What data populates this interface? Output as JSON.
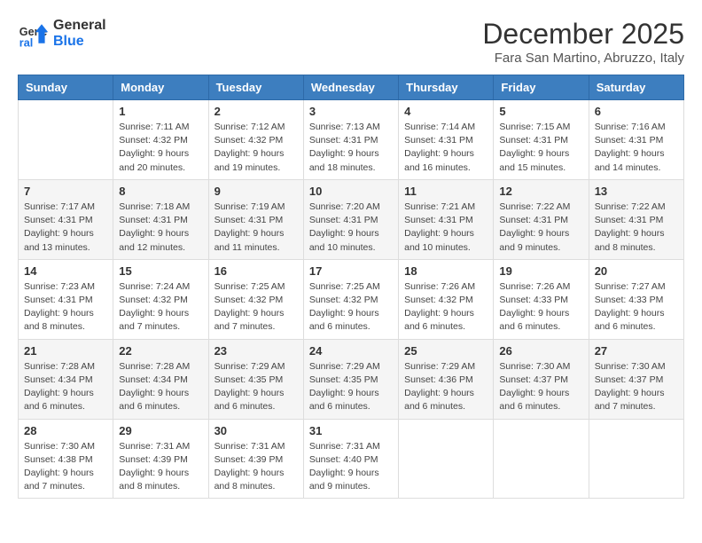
{
  "header": {
    "logo_line1": "General",
    "logo_line2": "Blue",
    "month": "December 2025",
    "location": "Fara San Martino, Abruzzo, Italy"
  },
  "weekdays": [
    "Sunday",
    "Monday",
    "Tuesday",
    "Wednesday",
    "Thursday",
    "Friday",
    "Saturday"
  ],
  "weeks": [
    [
      {
        "day": "",
        "info": ""
      },
      {
        "day": "1",
        "info": "Sunrise: 7:11 AM\nSunset: 4:32 PM\nDaylight: 9 hours\nand 20 minutes."
      },
      {
        "day": "2",
        "info": "Sunrise: 7:12 AM\nSunset: 4:32 PM\nDaylight: 9 hours\nand 19 minutes."
      },
      {
        "day": "3",
        "info": "Sunrise: 7:13 AM\nSunset: 4:31 PM\nDaylight: 9 hours\nand 18 minutes."
      },
      {
        "day": "4",
        "info": "Sunrise: 7:14 AM\nSunset: 4:31 PM\nDaylight: 9 hours\nand 16 minutes."
      },
      {
        "day": "5",
        "info": "Sunrise: 7:15 AM\nSunset: 4:31 PM\nDaylight: 9 hours\nand 15 minutes."
      },
      {
        "day": "6",
        "info": "Sunrise: 7:16 AM\nSunset: 4:31 PM\nDaylight: 9 hours\nand 14 minutes."
      }
    ],
    [
      {
        "day": "7",
        "info": "Sunrise: 7:17 AM\nSunset: 4:31 PM\nDaylight: 9 hours\nand 13 minutes."
      },
      {
        "day": "8",
        "info": "Sunrise: 7:18 AM\nSunset: 4:31 PM\nDaylight: 9 hours\nand 12 minutes."
      },
      {
        "day": "9",
        "info": "Sunrise: 7:19 AM\nSunset: 4:31 PM\nDaylight: 9 hours\nand 11 minutes."
      },
      {
        "day": "10",
        "info": "Sunrise: 7:20 AM\nSunset: 4:31 PM\nDaylight: 9 hours\nand 10 minutes."
      },
      {
        "day": "11",
        "info": "Sunrise: 7:21 AM\nSunset: 4:31 PM\nDaylight: 9 hours\nand 10 minutes."
      },
      {
        "day": "12",
        "info": "Sunrise: 7:22 AM\nSunset: 4:31 PM\nDaylight: 9 hours\nand 9 minutes."
      },
      {
        "day": "13",
        "info": "Sunrise: 7:22 AM\nSunset: 4:31 PM\nDaylight: 9 hours\nand 8 minutes."
      }
    ],
    [
      {
        "day": "14",
        "info": "Sunrise: 7:23 AM\nSunset: 4:31 PM\nDaylight: 9 hours\nand 8 minutes."
      },
      {
        "day": "15",
        "info": "Sunrise: 7:24 AM\nSunset: 4:32 PM\nDaylight: 9 hours\nand 7 minutes."
      },
      {
        "day": "16",
        "info": "Sunrise: 7:25 AM\nSunset: 4:32 PM\nDaylight: 9 hours\nand 7 minutes."
      },
      {
        "day": "17",
        "info": "Sunrise: 7:25 AM\nSunset: 4:32 PM\nDaylight: 9 hours\nand 6 minutes."
      },
      {
        "day": "18",
        "info": "Sunrise: 7:26 AM\nSunset: 4:32 PM\nDaylight: 9 hours\nand 6 minutes."
      },
      {
        "day": "19",
        "info": "Sunrise: 7:26 AM\nSunset: 4:33 PM\nDaylight: 9 hours\nand 6 minutes."
      },
      {
        "day": "20",
        "info": "Sunrise: 7:27 AM\nSunset: 4:33 PM\nDaylight: 9 hours\nand 6 minutes."
      }
    ],
    [
      {
        "day": "21",
        "info": "Sunrise: 7:28 AM\nSunset: 4:34 PM\nDaylight: 9 hours\nand 6 minutes."
      },
      {
        "day": "22",
        "info": "Sunrise: 7:28 AM\nSunset: 4:34 PM\nDaylight: 9 hours\nand 6 minutes."
      },
      {
        "day": "23",
        "info": "Sunrise: 7:29 AM\nSunset: 4:35 PM\nDaylight: 9 hours\nand 6 minutes."
      },
      {
        "day": "24",
        "info": "Sunrise: 7:29 AM\nSunset: 4:35 PM\nDaylight: 9 hours\nand 6 minutes."
      },
      {
        "day": "25",
        "info": "Sunrise: 7:29 AM\nSunset: 4:36 PM\nDaylight: 9 hours\nand 6 minutes."
      },
      {
        "day": "26",
        "info": "Sunrise: 7:30 AM\nSunset: 4:37 PM\nDaylight: 9 hours\nand 6 minutes."
      },
      {
        "day": "27",
        "info": "Sunrise: 7:30 AM\nSunset: 4:37 PM\nDaylight: 9 hours\nand 7 minutes."
      }
    ],
    [
      {
        "day": "28",
        "info": "Sunrise: 7:30 AM\nSunset: 4:38 PM\nDaylight: 9 hours\nand 7 minutes."
      },
      {
        "day": "29",
        "info": "Sunrise: 7:31 AM\nSunset: 4:39 PM\nDaylight: 9 hours\nand 8 minutes."
      },
      {
        "day": "30",
        "info": "Sunrise: 7:31 AM\nSunset: 4:39 PM\nDaylight: 9 hours\nand 8 minutes."
      },
      {
        "day": "31",
        "info": "Sunrise: 7:31 AM\nSunset: 4:40 PM\nDaylight: 9 hours\nand 9 minutes."
      },
      {
        "day": "",
        "info": ""
      },
      {
        "day": "",
        "info": ""
      },
      {
        "day": "",
        "info": ""
      }
    ]
  ]
}
